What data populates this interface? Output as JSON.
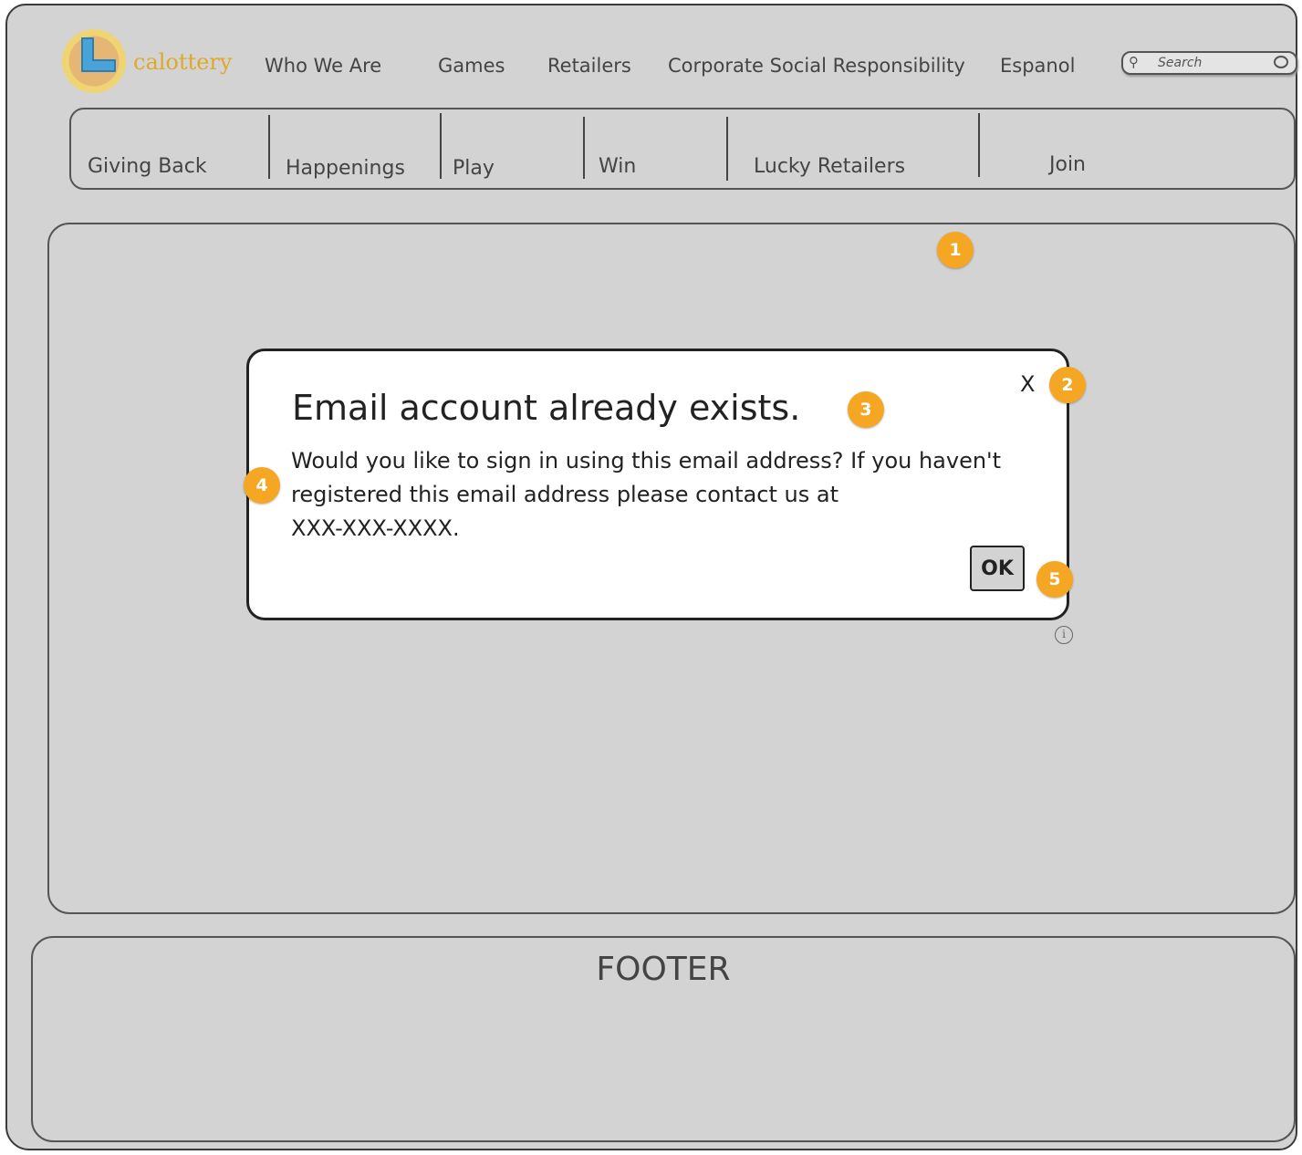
{
  "brand": {
    "name": "calottery"
  },
  "topnav": {
    "items": [
      "Who We Are",
      "Games",
      "Retailers",
      "Corporate Social Responsibility",
      "Espanol"
    ]
  },
  "search": {
    "placeholder": "Search"
  },
  "subnav": {
    "items": [
      "Giving Back",
      "Happenings",
      "Play",
      "Win",
      "Lucky Retailers",
      "Join"
    ]
  },
  "dialog": {
    "title": "Email account already exists.",
    "body_line1": "Would you like to sign in using this email address? If you haven't",
    "body_line2": "registered this email address please contact us at",
    "body_line3": "XXX-XXX-XXXX.",
    "close_label": "X",
    "ok_label": "OK"
  },
  "info_icon": "i",
  "footer": {
    "label": "FOOTER"
  },
  "markers": [
    "1",
    "2",
    "3",
    "4",
    "5"
  ],
  "colors": {
    "marker": "#f5a623",
    "background": "#d3d3d3",
    "dialog": "#ffffff"
  }
}
